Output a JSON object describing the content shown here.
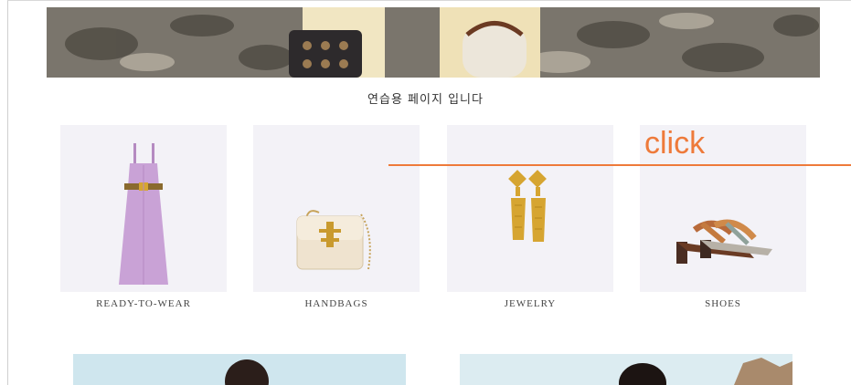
{
  "subtitle": "연습용 페이지 입니다",
  "categories": [
    {
      "label": "READY-TO-WEAR",
      "icon": "dress-icon"
    },
    {
      "label": "HANDBAGS",
      "icon": "handbag-icon"
    },
    {
      "label": "JEWELRY",
      "icon": "earrings-icon"
    },
    {
      "label": "SHOES",
      "icon": "sandals-icon"
    }
  ],
  "annotation": {
    "text": "click",
    "color": "#ee7a3a"
  },
  "colors": {
    "tile_bg": "#f3f2f7",
    "dress": "#c79fd3",
    "gold": "#d6a531"
  }
}
